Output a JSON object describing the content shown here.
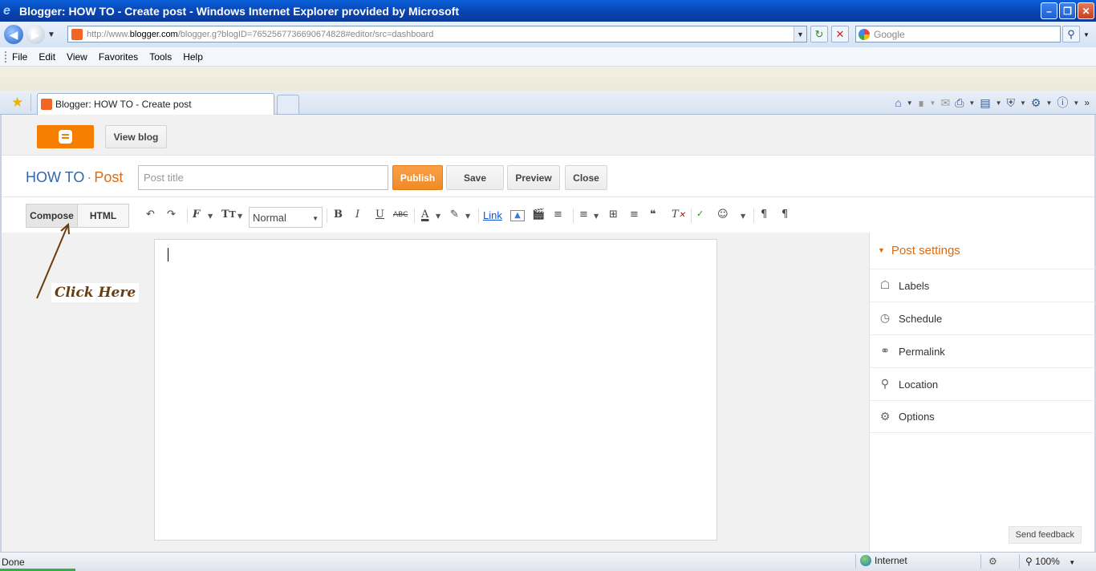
{
  "window": {
    "title": "Blogger: HOW TO - Create post - Windows Internet Explorer provided by Microsoft",
    "controls": [
      "minimize",
      "maximize",
      "close"
    ]
  },
  "browser": {
    "address_prefix": "http://www.",
    "address_host": "blogger.com",
    "address_path": "/blogger.g?blogID=7652567736690674828#editor/src=dashboard",
    "search_placeholder": "Google",
    "menu": [
      "File",
      "Edit",
      "View",
      "Favorites",
      "Tools",
      "Help"
    ],
    "tab_title": "Blogger: HOW TO - Create post"
  },
  "blogger": {
    "view_blog": "View blog",
    "blog_name": "HOW TO",
    "separator": "·",
    "section": "Post",
    "post_title_placeholder": "Post title",
    "actions": {
      "publish": "Publish",
      "save": "Save",
      "preview": "Preview",
      "close": "Close"
    },
    "mode_tabs": {
      "compose": "Compose",
      "html": "HTML"
    },
    "font_size": "Normal",
    "link_label": "Link",
    "post_settings": {
      "heading": "Post settings",
      "items": [
        {
          "label": "Labels",
          "icon": "tag-icon"
        },
        {
          "label": "Schedule",
          "icon": "clock-icon"
        },
        {
          "label": "Permalink",
          "icon": "link-icon"
        },
        {
          "label": "Location",
          "icon": "pin-icon"
        },
        {
          "label": "Options",
          "icon": "gear-icon"
        }
      ]
    },
    "send_feedback": "Send feedback",
    "annotation": "Click Here"
  },
  "status": {
    "text": "Done",
    "zone": "Internet",
    "zoom": "100%"
  },
  "colors": {
    "blogger_orange": "#f57d00",
    "publish_orange": "#f08a25",
    "accent_blue": "#3366aa"
  }
}
